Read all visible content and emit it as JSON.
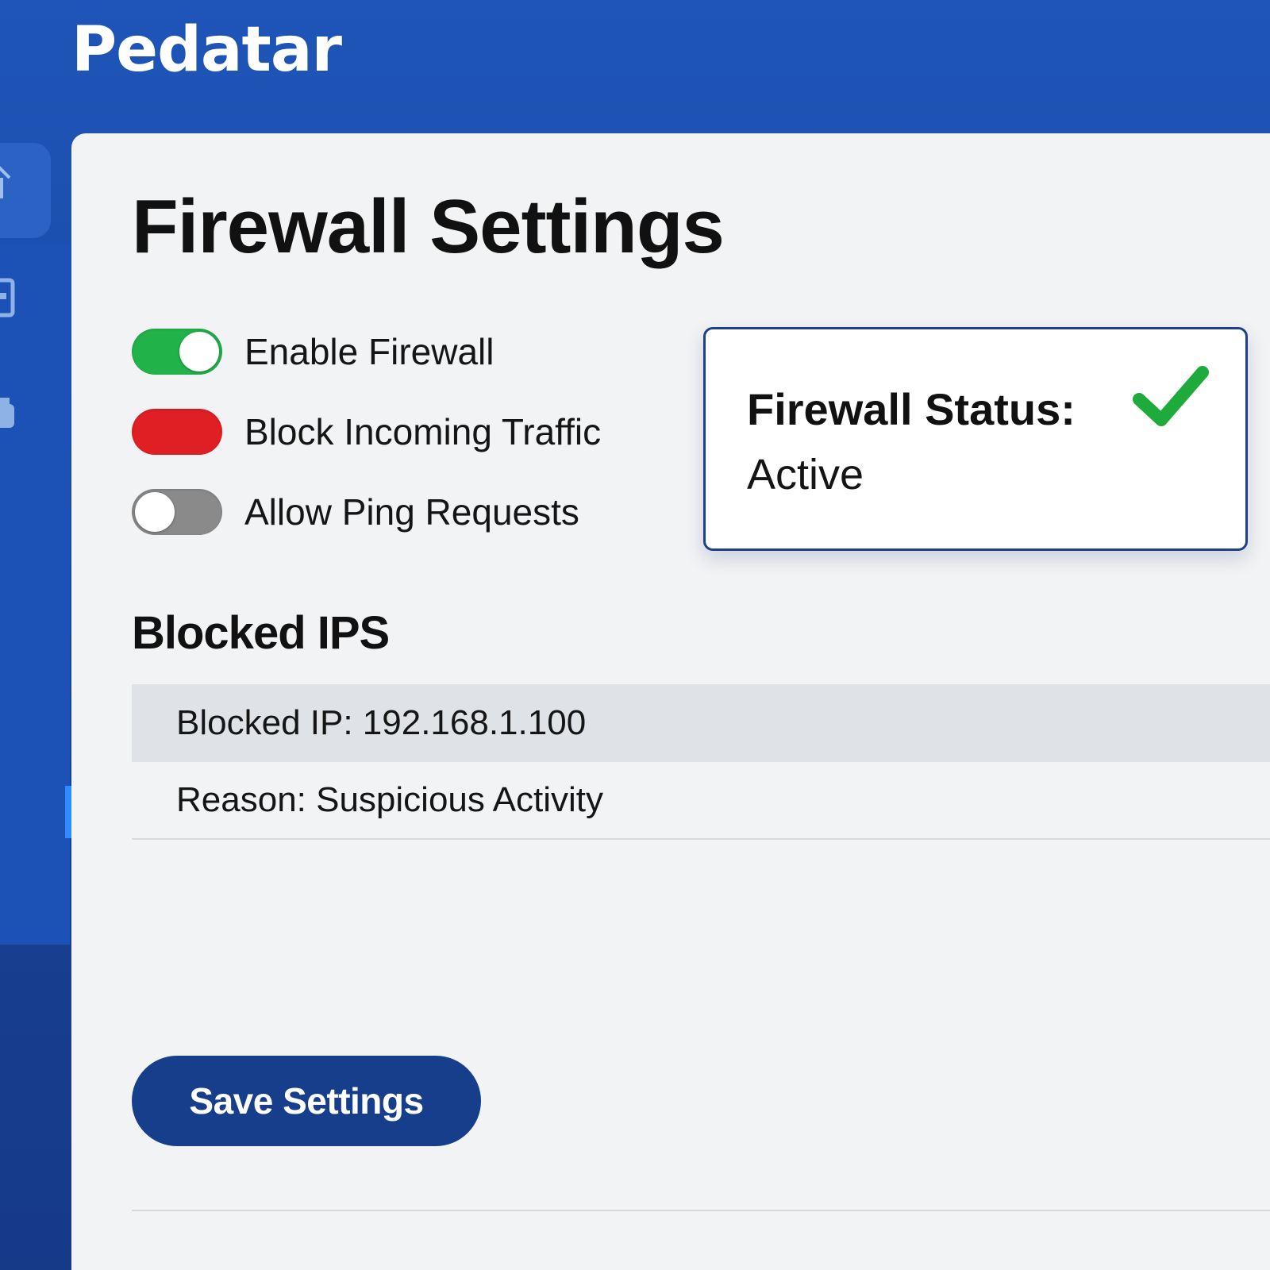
{
  "app": {
    "brand": "Pedatar"
  },
  "sidebar": {
    "icons": [
      "home-icon",
      "document-icon",
      "printer-icon"
    ]
  },
  "page": {
    "title": "Firewall Settings"
  },
  "toggles": [
    {
      "label": "Enable Firewall",
      "state": "on",
      "color": "#22b24a"
    },
    {
      "label": "Block Incoming Traffic",
      "state": "on",
      "color": "#e01f24"
    },
    {
      "label": "Allow Ping Requests",
      "state": "off",
      "color": "#8a8a8a"
    }
  ],
  "status": {
    "title": "Firewall Status:",
    "value": "Active",
    "icon": "check-icon",
    "icon_color": "#1faa3c"
  },
  "blocked": {
    "section_title": "Blocked IPS",
    "rows": [
      {
        "text": "Blocked IP: 192.168.1.100"
      },
      {
        "text": "Reason: Suspicious Activity"
      }
    ]
  },
  "actions": {
    "save_label": "Save Settings"
  },
  "colors": {
    "header_blue": "#1f55b8",
    "button_navy": "#173e8a",
    "panel_bg": "#f2f3f4"
  }
}
